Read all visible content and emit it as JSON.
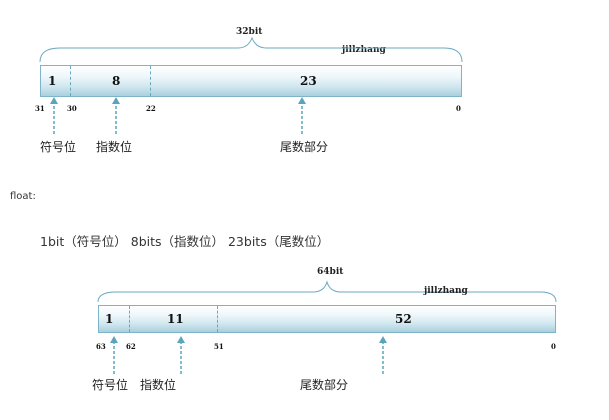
{
  "diagram32": {
    "total_label": "32bit",
    "watermark": "jillzhang",
    "fields": [
      "1",
      "8",
      "23"
    ],
    "bit_positions": [
      "31",
      "30",
      "22",
      "0"
    ],
    "captions": [
      "符号位",
      "指数位",
      "尾数部分"
    ]
  },
  "text": {
    "float_label": "float:",
    "description": "1bit（符号位） 8bits（指数位） 23bits（尾数位）"
  },
  "diagram64": {
    "total_label": "64bit",
    "watermark": "jillzhang",
    "fields": [
      "1",
      "11",
      "52"
    ],
    "bit_positions": [
      "63",
      "62",
      "51",
      "0"
    ],
    "captions": [
      "符号位",
      "指数位",
      "尾数部分"
    ]
  },
  "colors": {
    "bar_border": "#7fb3c8",
    "arrow": "#5aa5bd",
    "brace": "#6aa8c0"
  }
}
